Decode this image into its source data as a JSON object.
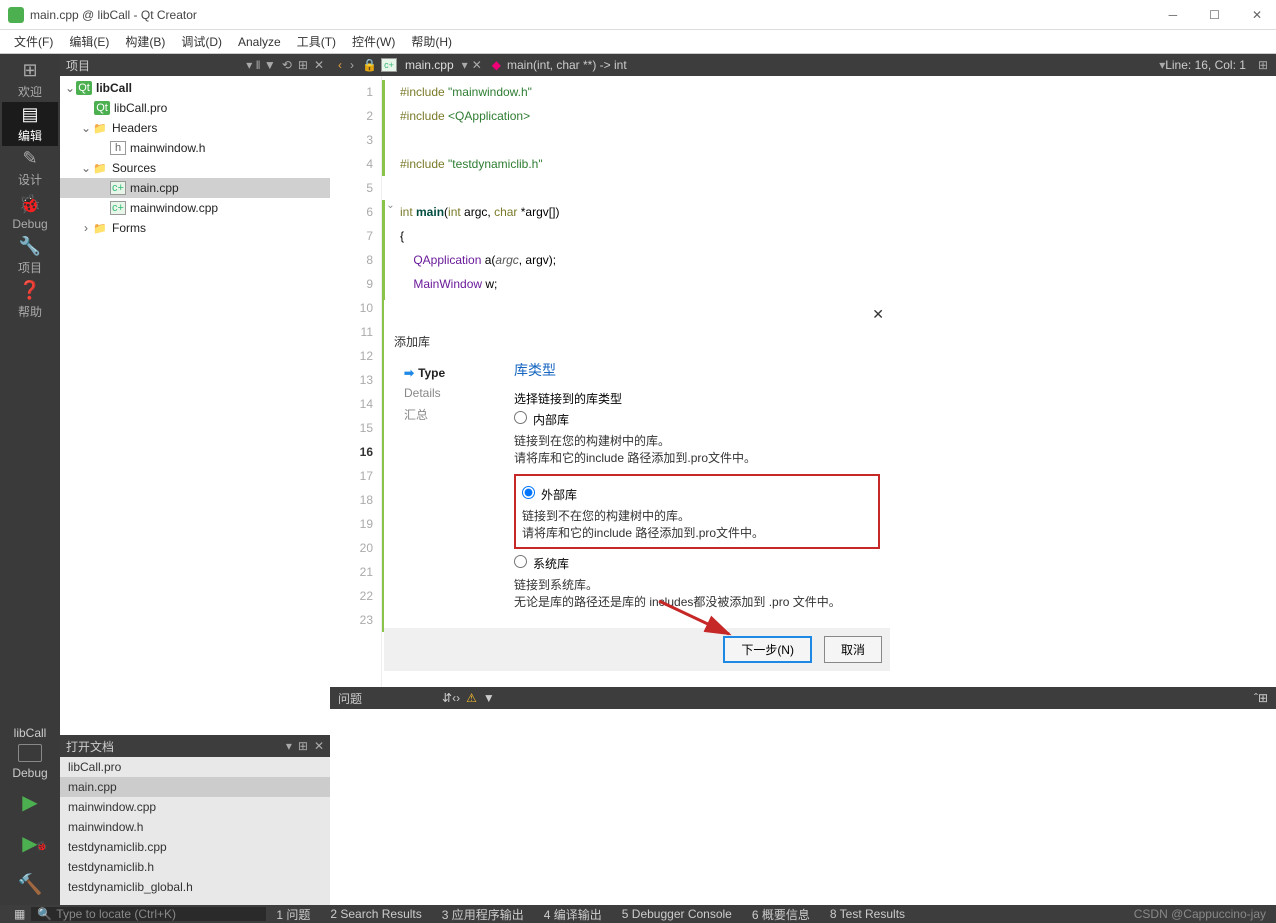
{
  "window": {
    "title": "main.cpp @ libCall - Qt Creator"
  },
  "menu": {
    "file": "文件(F)",
    "edit": "编辑(E)",
    "build": "构建(B)",
    "debug": "调试(D)",
    "analyze": "Analyze",
    "tools": "工具(T)",
    "widgets": "控件(W)",
    "help": "帮助(H)"
  },
  "sidebar": {
    "welcome": "欢迎",
    "edit": "编辑",
    "design": "设计",
    "debug": "Debug",
    "project": "项目",
    "help": "帮助"
  },
  "kit": {
    "name": "libCall",
    "mode": "Debug"
  },
  "project_panel": {
    "title": "项目"
  },
  "tree": {
    "root": "libCall",
    "pro": "libCall.pro",
    "headers": "Headers",
    "header1": "mainwindow.h",
    "sources": "Sources",
    "source1": "main.cpp",
    "source2": "mainwindow.cpp",
    "forms": "Forms"
  },
  "opendocs": {
    "title": "打开文档",
    "items": [
      "libCall.pro",
      "main.cpp",
      "mainwindow.cpp",
      "mainwindow.h",
      "testdynamiclib.cpp",
      "testdynamiclib.h",
      "testdynamiclib_global.h"
    ]
  },
  "editor": {
    "tab": "main.cpp",
    "crumb": "main(int, char **) -> int",
    "pos": "Line: 16, Col: 1",
    "lines": {
      "l1a": "#include ",
      "l1b": "\"mainwindow.h\"",
      "l2a": "#include ",
      "l2b": "<QApplication>",
      "l4a": "#include ",
      "l4b": "\"testdynamiclib.h\"",
      "l6a": "int ",
      "l6b": "main",
      "l6c": "(",
      "l6d": "int",
      "l6e": " argc, ",
      "l6f": "char",
      "l6g": " *argv[])",
      "l7": "{",
      "l8a": "    ",
      "l8b": "QApplication",
      "l8c": " a(",
      "l8d": "argc",
      "l8e": ", argv);",
      "l9a": "    ",
      "l9b": "MainWindow",
      "l9c": " w;"
    }
  },
  "issues": {
    "title": "问题"
  },
  "status": {
    "locate": "Type to locate (Ctrl+K)",
    "t1": "1  问题",
    "t2": "2  Search Results",
    "t3": "3  应用程序输出",
    "t4": "4  编译输出",
    "t5": "5  Debugger Console",
    "t6": "6  概要信息",
    "t8": "8  Test Results",
    "csdn": "CSDN @Cappuccino-jay"
  },
  "dialog": {
    "title": "添加库",
    "steps": {
      "type": "Type",
      "details": "Details",
      "summary": "汇总"
    },
    "heading": "库类型",
    "sub": "选择链接到的库类型",
    "opt_internal": "内部库",
    "desc_internal_1": "链接到在您的构建树中的库。",
    "desc_internal_2": "请将库和它的include 路径添加到.pro文件中。",
    "opt_external": "外部库",
    "desc_external_1": "链接到不在您的构建树中的库。",
    "desc_external_2": "请将库和它的include 路径添加到.pro文件中。",
    "opt_system": "系统库",
    "desc_system_1": "链接到系统库。",
    "desc_system_2": "无论是库的路径还是库的 includes都没被添加到 .pro 文件中。",
    "next": "下一步(N)",
    "cancel": "取消"
  }
}
